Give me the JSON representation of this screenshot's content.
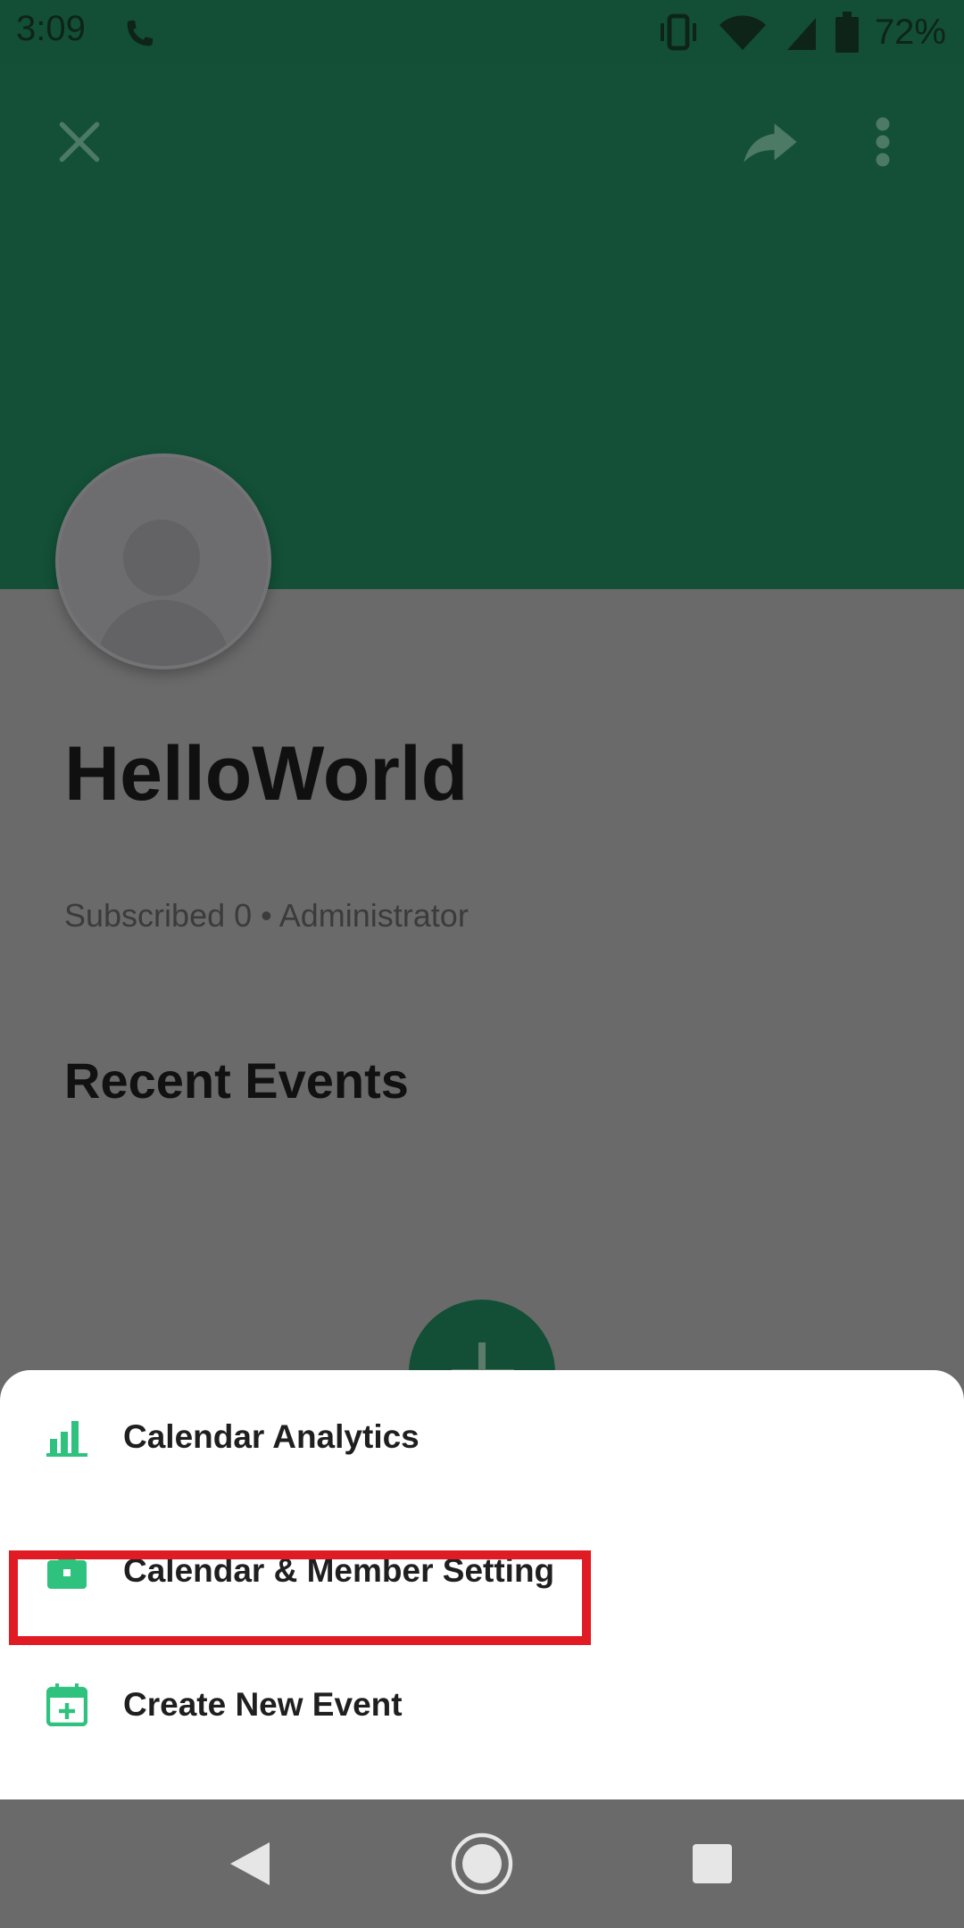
{
  "status_bar": {
    "time": "3:09",
    "battery": "72%",
    "icons": [
      "call-icon",
      "vibrate-icon",
      "wifi-icon",
      "signal-icon",
      "battery-icon"
    ]
  },
  "header": {
    "color": "#135037",
    "actions": [
      "close-icon",
      "share-icon",
      "more-vert-icon"
    ]
  },
  "profile": {
    "name": "HelloWorld",
    "subtitle": "Subscribed 0 • Administrator",
    "section_title": "Recent Events"
  },
  "bottom_sheet": {
    "accent": "#2ec27e",
    "items": [
      {
        "label": "Calendar Analytics",
        "icon": "bar-chart-icon"
      },
      {
        "label": "Calendar & Member Setting",
        "icon": "briefcase-icon"
      },
      {
        "label": "Create New Event",
        "icon": "calendar-add-icon"
      }
    ],
    "highlight_color": "#e11b24"
  },
  "nav_bar": {
    "buttons": [
      "back-icon",
      "home-icon",
      "recents-icon"
    ]
  }
}
